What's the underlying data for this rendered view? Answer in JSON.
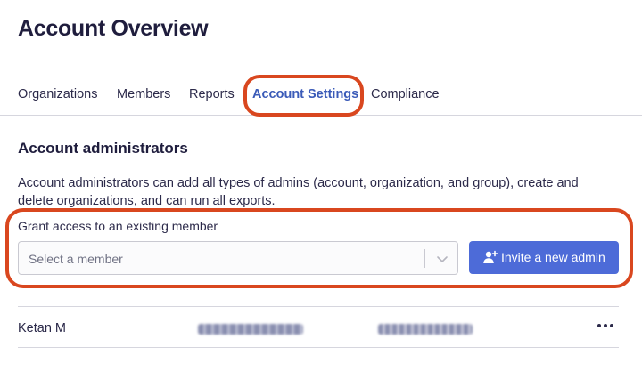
{
  "page": {
    "title": "Account Overview"
  },
  "tabs": [
    {
      "label": "Organizations",
      "active": false
    },
    {
      "label": "Members",
      "active": false
    },
    {
      "label": "Reports",
      "active": false
    },
    {
      "label": "Account Settings",
      "active": true
    },
    {
      "label": "Compliance",
      "active": false
    }
  ],
  "section": {
    "title": "Account administrators",
    "description": "Account administrators can add all types of admins (account, organization, and group), create and delete organizations, and can run all exports."
  },
  "grant": {
    "label": "Grant access to an existing member",
    "select_placeholder": "Select a member",
    "select_icon": "chevron-down-icon",
    "invite_label": "Invite a new admin",
    "invite_icon": "add-user-icon"
  },
  "admins": [
    {
      "name": "Ketan M"
    }
  ],
  "colors": {
    "accent": "#4d6bd8",
    "active_tab": "#3b5bb8",
    "highlight": "#d9471f"
  }
}
